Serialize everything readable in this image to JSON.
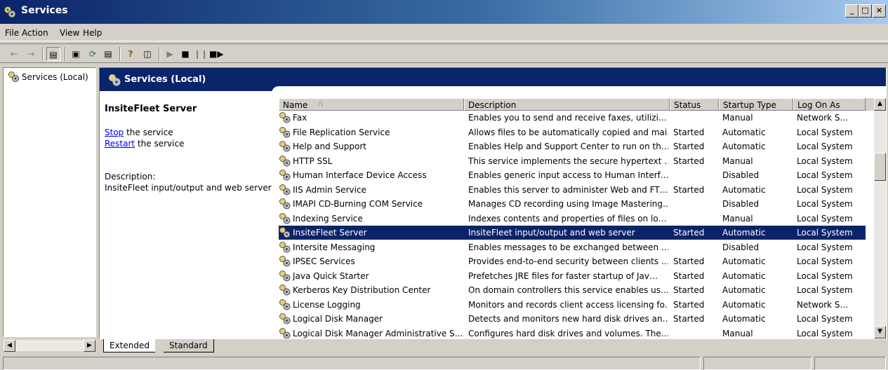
{
  "window": {
    "title": "Services",
    "min": "_",
    "max": "□",
    "close": "×"
  },
  "menu": [
    "File",
    "Action",
    "View",
    "Help"
  ],
  "toolbar_icons": [
    "back-icon",
    "forward-icon",
    "show-hide-tree-icon",
    "properties-icon",
    "refresh-icon",
    "export-list-icon",
    "help-icon",
    "show-hide-action-pane-icon",
    "start-service-icon",
    "stop-service-icon",
    "pause-service-icon",
    "restart-service-icon"
  ],
  "tree": {
    "root_label": "Services (Local)"
  },
  "panel": {
    "header": "Services (Local)"
  },
  "details": {
    "service_name": "InsiteFleet Server",
    "stop_link": "Stop",
    "stop_rest": " the service",
    "restart_link": "Restart",
    "restart_rest": " the service",
    "description_label": "Description:",
    "description_text": "InsiteFleet input/output and web server"
  },
  "columns": [
    "Name",
    "Description",
    "Status",
    "Startup Type",
    "Log On As"
  ],
  "sort_indicator": "/\\",
  "rows": [
    {
      "name": "Fax",
      "description": "Enables you to send and receive faxes, utilizi…",
      "status": "",
      "startup": "Manual",
      "logon": "Network S…"
    },
    {
      "name": "File Replication Service",
      "description": "Allows files to be automatically copied and mai…",
      "status": "Started",
      "startup": "Automatic",
      "logon": "Local System"
    },
    {
      "name": "Help and Support",
      "description": "Enables Help and Support Center to run on th…",
      "status": "Started",
      "startup": "Automatic",
      "logon": "Local System"
    },
    {
      "name": "HTTP SSL",
      "description": "This service implements the secure hypertext …",
      "status": "Started",
      "startup": "Manual",
      "logon": "Local System"
    },
    {
      "name": "Human Interface Device Access",
      "description": "Enables generic input access to Human Interf…",
      "status": "",
      "startup": "Disabled",
      "logon": "Local System"
    },
    {
      "name": "IIS Admin Service",
      "description": "Enables this server to administer Web and FT…",
      "status": "Started",
      "startup": "Automatic",
      "logon": "Local System"
    },
    {
      "name": "IMAPI CD-Burning COM Service",
      "description": "Manages CD recording using Image Mastering…",
      "status": "",
      "startup": "Disabled",
      "logon": "Local System"
    },
    {
      "name": "Indexing Service",
      "description": "Indexes contents and properties of files on lo…",
      "status": "",
      "startup": "Manual",
      "logon": "Local System"
    },
    {
      "name": "InsiteFleet Server",
      "description": "InsiteFleet input/output and web server",
      "status": "Started",
      "startup": "Automatic",
      "logon": "Local System",
      "selected": true
    },
    {
      "name": "Intersite Messaging",
      "description": "Enables messages to be exchanged between …",
      "status": "",
      "startup": "Disabled",
      "logon": "Local System"
    },
    {
      "name": "IPSEC Services",
      "description": "Provides end-to-end security between clients …",
      "status": "Started",
      "startup": "Automatic",
      "logon": "Local System"
    },
    {
      "name": "Java Quick Starter",
      "description": "Prefetches JRE files for faster startup of Jav…",
      "status": "Started",
      "startup": "Automatic",
      "logon": "Local System"
    },
    {
      "name": "Kerberos Key Distribution Center",
      "description": "On domain controllers this service enables us…",
      "status": "Started",
      "startup": "Automatic",
      "logon": "Local System"
    },
    {
      "name": "License Logging",
      "description": "Monitors and records client access licensing fo…",
      "status": "Started",
      "startup": "Automatic",
      "logon": "Network S…"
    },
    {
      "name": "Logical Disk Manager",
      "description": "Detects and monitors new hard disk drives an…",
      "status": "Started",
      "startup": "Automatic",
      "logon": "Local System"
    },
    {
      "name": "Logical Disk Manager Administrative S…",
      "description": "Configures hard disk drives and volumes. The…",
      "status": "",
      "startup": "Manual",
      "logon": "Local System"
    }
  ],
  "tabs": [
    "Extended",
    "Standard"
  ]
}
